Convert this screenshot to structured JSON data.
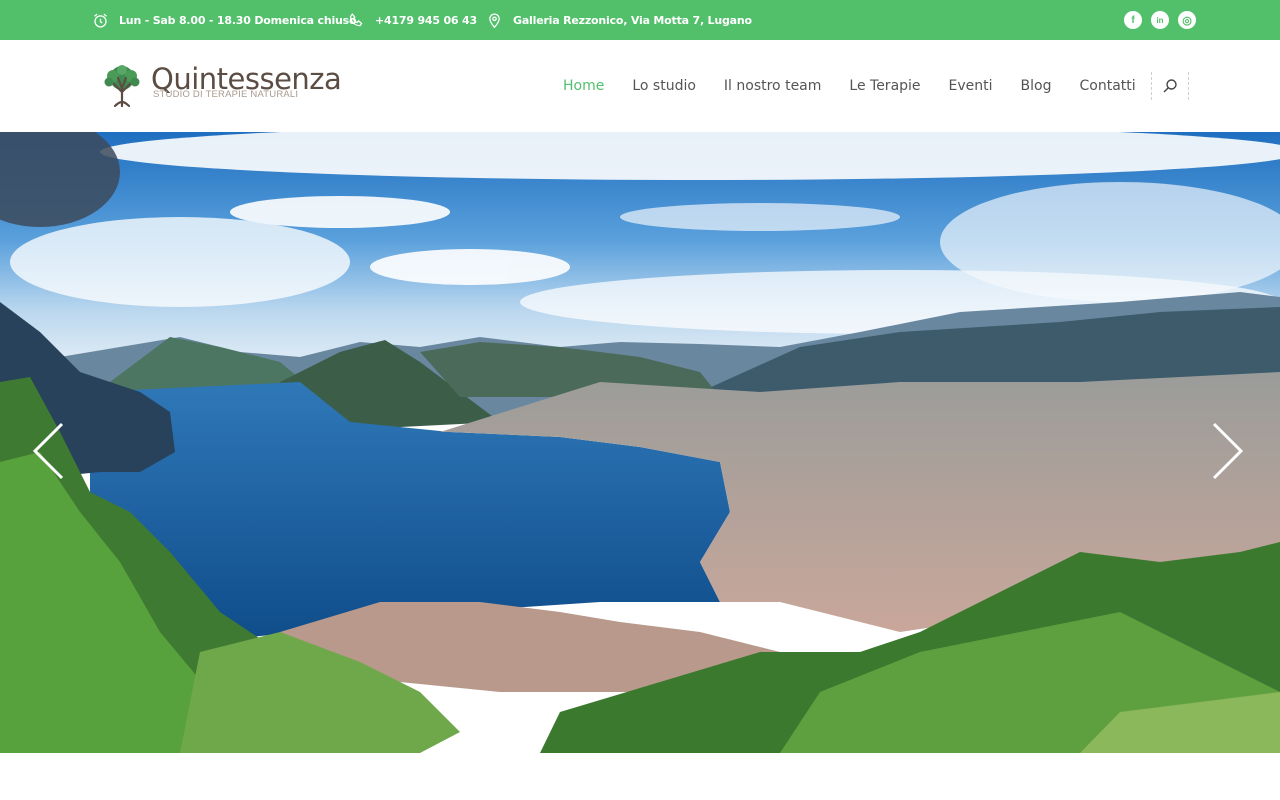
{
  "topbar": {
    "hours": "Lun - Sab 8.00 - 18.30 Domenica chiuso",
    "phone": "+4179 945 06 43",
    "address": "Galleria Rezzonico, Via Motta 7, Lugano",
    "socials": [
      {
        "name": "facebook-icon",
        "glyph": "f"
      },
      {
        "name": "linkedin-icon",
        "glyph": "in"
      },
      {
        "name": "instagram-icon",
        "glyph": "◎"
      }
    ]
  },
  "logo": {
    "name": "Quintessenza",
    "tagline": "STUDIO DI TERAPIE NATURALI"
  },
  "nav": {
    "items": [
      "Home",
      "Lo studio",
      "Il nostro team",
      "Le Terapie",
      "Eventi",
      "Blog",
      "Contatti"
    ],
    "active": "Home"
  },
  "colors": {
    "accent": "#52bf6b",
    "nav_text": "#555555",
    "logo_brown": "#5c4d44"
  },
  "hero": {
    "image": "panorama of Lake Lugano and the city of Lugano with mountains",
    "prev_icon": "chevron-left-icon",
    "next_icon": "chevron-right-icon"
  }
}
